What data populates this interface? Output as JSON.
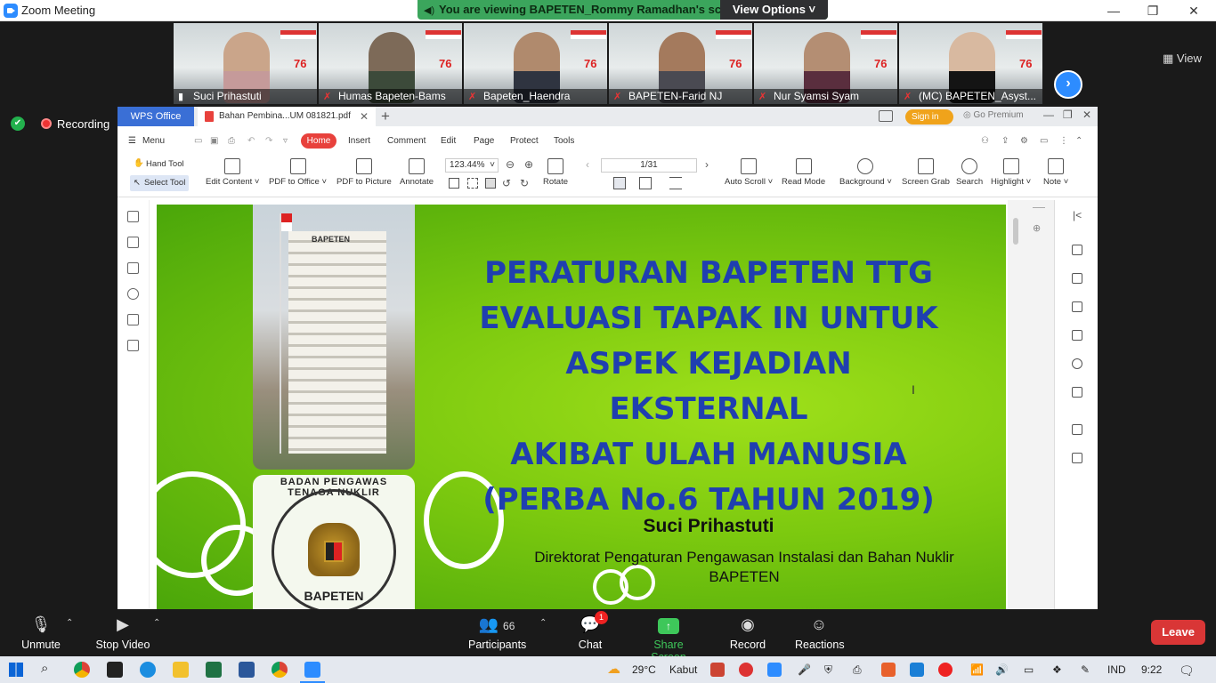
{
  "window": {
    "title": "Zoom Meeting"
  },
  "banner": {
    "text": "You are viewing BAPETEN_Rommy Ramadhan's screen",
    "view_options": "View Options"
  },
  "gallery": {
    "participants": [
      {
        "name": "Suci Prihastuti",
        "skin": "#caa58a",
        "cloth": "#c59a9a",
        "active": true
      },
      {
        "name": "Humas Bapeten-Bams",
        "skin": "#7d6a58",
        "cloth": "#3c4a3a",
        "active": false
      },
      {
        "name": "Bapeten_Haendra",
        "skin": "#b08a6d",
        "cloth": "#2f3440",
        "active": false
      },
      {
        "name": "BAPETEN-Farid NJ",
        "skin": "#a47a5d",
        "cloth": "#4a4a52",
        "active": false
      },
      {
        "name": "Nur Syamsi Syam",
        "skin": "#b48e73",
        "cloth": "#5a2e3e",
        "active": false
      },
      {
        "name": "(MC) BAPETEN_Asyst...",
        "skin": "#d8b9a0",
        "cloth": "#141414",
        "active": false
      }
    ],
    "view_label": "View"
  },
  "recording": {
    "label": "Recording"
  },
  "wps": {
    "office_tab": "WPS Office",
    "doc_tab": "Bahan Pembina...UM 081821.pdf",
    "sign_in": "Sign in",
    "go_premium": "Go Premium",
    "menu": [
      "Menu",
      "Home",
      "Insert",
      "Comment",
      "Edit",
      "Page",
      "Protect",
      "Tools"
    ],
    "ribbon": {
      "hand_tool": "Hand Tool",
      "select_tool": "Select Tool",
      "edit_content": "Edit Content ˅",
      "pdf_to_office": "PDF to Office ˅",
      "pdf_to_picture": "PDF to Picture",
      "annotate": "Annotate",
      "zoom": "123.44%",
      "page": "1/31",
      "rotate": "Rotate",
      "auto_scroll": "Auto Scroll ˅",
      "read_mode": "Read Mode",
      "background": "Background ˅",
      "screen_grab": "Screen Grab",
      "search": "Search",
      "highlight": "Highlight ˅",
      "note": "Note ˅"
    }
  },
  "slide": {
    "title_lines": [
      "PERATURAN BAPETEN TTG",
      "EVALUASI TAPAK IN UNTUK",
      "ASPEK KEJADIAN EKSTERNAL",
      "AKIBAT ULAH MANUSIA",
      "(PERBA No.6 TAHUN 2019)"
    ],
    "author": "Suci Prihastuti",
    "directorate": "Direktorat Pengaturan Pengawasan Instalasi dan Bahan Nuklir",
    "org": "BAPETEN",
    "building_sign": "BAPETEN",
    "emblem_top": "BADAN PENGAWAS TENAGA NUKLIR",
    "emblem_bottom": "BAPETEN"
  },
  "controls": {
    "unmute": "Unmute",
    "stop_video": "Stop Video",
    "participants_count": "66",
    "participants": "Participants",
    "chat": "Chat",
    "chat_badge": "1",
    "share_screen": "Share Screen",
    "record": "Record",
    "reactions": "Reactions",
    "leave": "Leave"
  },
  "taskbar": {
    "temperature": "29°C",
    "weather": "Kabut",
    "lang": "IND",
    "time": "9:22"
  }
}
